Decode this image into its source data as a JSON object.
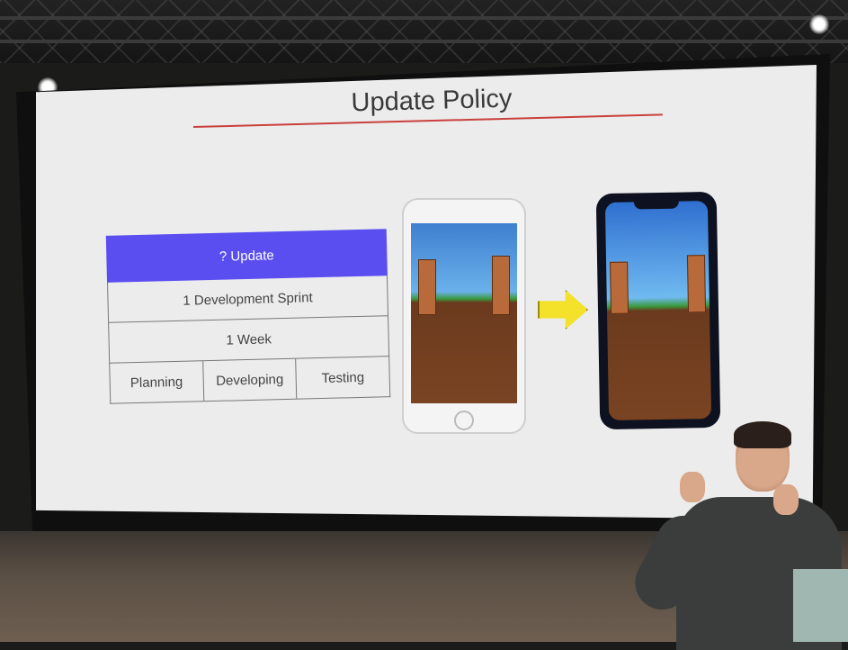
{
  "slide": {
    "title": "Update Policy",
    "table": {
      "update_label": "? Update",
      "sprint_label": "1 Development Sprint",
      "week_label": "1 Week",
      "phases": [
        "Planning",
        "Developing",
        "Testing"
      ]
    }
  },
  "colors": {
    "update_bar": "#5a4ef0",
    "title_rule": "#c9403c",
    "arrow": "#f3e12a"
  },
  "icons": [
    "arrow-right-icon",
    "phone-icon",
    "spotlight-icon"
  ]
}
